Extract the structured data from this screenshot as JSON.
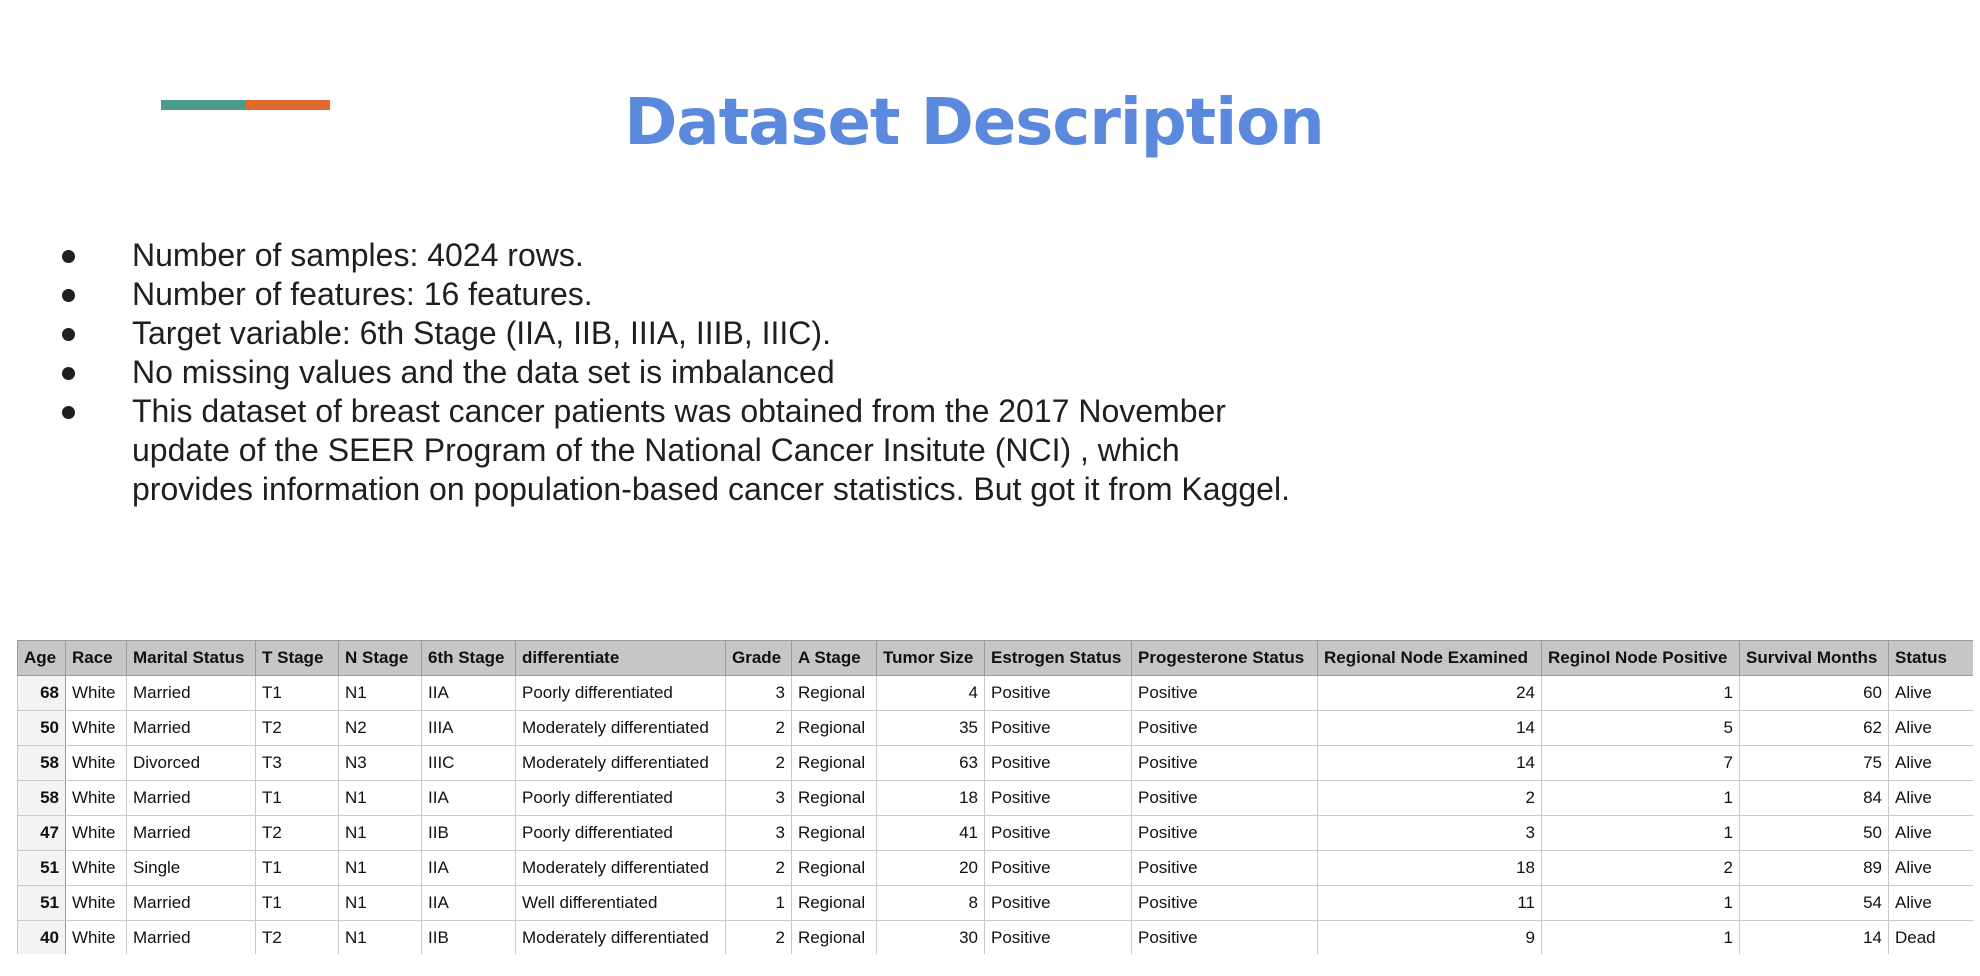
{
  "title": "Dataset Description",
  "colors": {
    "accent_teal": "#4a9b8a",
    "accent_orange": "#e06a2b",
    "title": "#5b89de"
  },
  "bullets": [
    "Number of samples: 4024 rows.",
    "Number of features: 16 features.",
    "Target variable: 6th Stage (IIA, IIB, IIIA, IIIB, IIIC).",
    "No missing values and the data set is imbalanced",
    "This dataset of breast cancer patients was obtained from the 2017 November update of the SEER Program of the National Cancer Insitute (NCI) , which provides information on population-based cancer statistics. But got it from Kaggel."
  ],
  "table": {
    "headers": [
      "Age",
      "Race",
      "Marital Status",
      "T Stage",
      "N Stage",
      "6th Stage",
      "differentiate",
      "Grade",
      "A Stage",
      "Tumor Size",
      "Estrogen Status",
      "Progesterone Status",
      "Regional Node Examined",
      "Reginol Node Positive",
      "Survival Months",
      "Status"
    ],
    "rows": [
      [
        "68",
        "White",
        "Married",
        "T1",
        "N1",
        "IIA",
        "Poorly differentiated",
        "3",
        "Regional",
        "4",
        "Positive",
        "Positive",
        "24",
        "1",
        "60",
        "Alive"
      ],
      [
        "50",
        "White",
        "Married",
        "T2",
        "N2",
        "IIIA",
        "Moderately differentiated",
        "2",
        "Regional",
        "35",
        "Positive",
        "Positive",
        "14",
        "5",
        "62",
        "Alive"
      ],
      [
        "58",
        "White",
        "Divorced",
        "T3",
        "N3",
        "IIIC",
        "Moderately differentiated",
        "2",
        "Regional",
        "63",
        "Positive",
        "Positive",
        "14",
        "7",
        "75",
        "Alive"
      ],
      [
        "58",
        "White",
        "Married",
        "T1",
        "N1",
        "IIA",
        "Poorly differentiated",
        "3",
        "Regional",
        "18",
        "Positive",
        "Positive",
        "2",
        "1",
        "84",
        "Alive"
      ],
      [
        "47",
        "White",
        "Married",
        "T2",
        "N1",
        "IIB",
        "Poorly differentiated",
        "3",
        "Regional",
        "41",
        "Positive",
        "Positive",
        "3",
        "1",
        "50",
        "Alive"
      ],
      [
        "51",
        "White",
        "Single",
        "T1",
        "N1",
        "IIA",
        "Moderately differentiated",
        "2",
        "Regional",
        "20",
        "Positive",
        "Positive",
        "18",
        "2",
        "89",
        "Alive"
      ],
      [
        "51",
        "White",
        "Married",
        "T1",
        "N1",
        "IIA",
        "Well differentiated",
        "1",
        "Regional",
        "8",
        "Positive",
        "Positive",
        "11",
        "1",
        "54",
        "Alive"
      ],
      [
        "40",
        "White",
        "Married",
        "T2",
        "N1",
        "IIB",
        "Moderately differentiated",
        "2",
        "Regional",
        "30",
        "Positive",
        "Positive",
        "9",
        "1",
        "14",
        "Dead"
      ]
    ]
  }
}
